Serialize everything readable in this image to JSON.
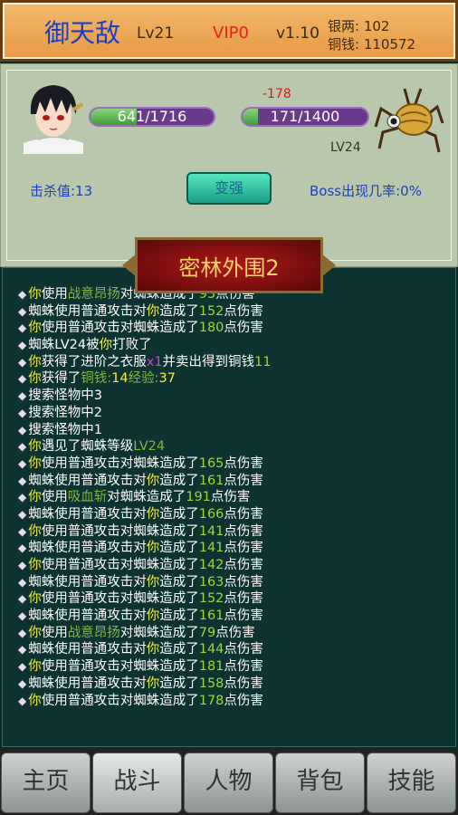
{
  "header": {
    "player_name": "御天敌",
    "level": "Lv21",
    "vip": "VIP0",
    "version": "v1.10",
    "silver": "银两: 102",
    "copper": "铜钱: 110572"
  },
  "battle": {
    "player_hp": "641/1716",
    "player_hp_fraction": 0.374,
    "enemy_hp": "171/1400",
    "enemy_hp_fraction": 0.122,
    "damage_popup": "-178",
    "enemy_level": "LV24",
    "kill_label": "击杀值:13",
    "boss_rate": "Boss出现几率:0%",
    "strengthen_button": "变强"
  },
  "zone_title": "密林外围2",
  "log": [
    [
      {
        "t": "你",
        "c": "you"
      },
      {
        "t": "使用"
      },
      {
        "t": "战意昂扬",
        "c": "skill"
      },
      {
        "t": "对蜘蛛造成了"
      },
      {
        "t": "93",
        "c": "num"
      },
      {
        "t": "点伤害"
      }
    ],
    [
      {
        "t": "蜘蛛使用普通攻击对"
      },
      {
        "t": "你",
        "c": "you"
      },
      {
        "t": "造成了"
      },
      {
        "t": "152",
        "c": "num"
      },
      {
        "t": "点伤害"
      }
    ],
    [
      {
        "t": "你",
        "c": "you"
      },
      {
        "t": "使用普通攻击对蜘蛛造成了"
      },
      {
        "t": "180",
        "c": "num"
      },
      {
        "t": "点伤害"
      }
    ],
    [
      {
        "t": "蜘蛛LV24被"
      },
      {
        "t": "你",
        "c": "you"
      },
      {
        "t": "打败了"
      }
    ],
    [
      {
        "t": "你",
        "c": "you"
      },
      {
        "t": "获得了进阶之衣服"
      },
      {
        "t": "x1",
        "c": "mag"
      },
      {
        "t": "并卖出得到铜钱"
      },
      {
        "t": "11",
        "c": "num"
      }
    ],
    [
      {
        "t": "你",
        "c": "you"
      },
      {
        "t": "获得了"
      },
      {
        "t": "铜钱:",
        "c": "skill"
      },
      {
        "t": "14",
        "c": "you"
      },
      {
        "t": "经验:",
        "c": "skill"
      },
      {
        "t": "37",
        "c": "you"
      }
    ],
    [
      {
        "t": "搜索怪物中3"
      }
    ],
    [
      {
        "t": "搜索怪物中2"
      }
    ],
    [
      {
        "t": "搜索怪物中1"
      }
    ],
    [
      {
        "t": "你",
        "c": "you"
      },
      {
        "t": "遇见了蜘蛛等级"
      },
      {
        "t": "LV24",
        "c": "skill"
      }
    ],
    [
      {
        "t": "你",
        "c": "you"
      },
      {
        "t": "使用普通攻击对蜘蛛造成了"
      },
      {
        "t": "165",
        "c": "num"
      },
      {
        "t": "点伤害"
      }
    ],
    [
      {
        "t": "蜘蛛使用普通攻击对"
      },
      {
        "t": "你",
        "c": "you"
      },
      {
        "t": "造成了"
      },
      {
        "t": "161",
        "c": "num"
      },
      {
        "t": "点伤害"
      }
    ],
    [
      {
        "t": "你",
        "c": "you"
      },
      {
        "t": "使用"
      },
      {
        "t": "吸血斩",
        "c": "skill"
      },
      {
        "t": "对蜘蛛造成了"
      },
      {
        "t": "191",
        "c": "num"
      },
      {
        "t": "点伤害"
      }
    ],
    [
      {
        "t": "蜘蛛使用普通攻击对"
      },
      {
        "t": "你",
        "c": "you"
      },
      {
        "t": "造成了"
      },
      {
        "t": "166",
        "c": "num"
      },
      {
        "t": "点伤害"
      }
    ],
    [
      {
        "t": "你",
        "c": "you"
      },
      {
        "t": "使用普通攻击对蜘蛛造成了"
      },
      {
        "t": "141",
        "c": "num"
      },
      {
        "t": "点伤害"
      }
    ],
    [
      {
        "t": "蜘蛛使用普通攻击对"
      },
      {
        "t": "你",
        "c": "you"
      },
      {
        "t": "造成了"
      },
      {
        "t": "141",
        "c": "num"
      },
      {
        "t": "点伤害"
      }
    ],
    [
      {
        "t": "你",
        "c": "you"
      },
      {
        "t": "使用普通攻击对蜘蛛造成了"
      },
      {
        "t": "142",
        "c": "num"
      },
      {
        "t": "点伤害"
      }
    ],
    [
      {
        "t": "蜘蛛使用普通攻击对"
      },
      {
        "t": "你",
        "c": "you"
      },
      {
        "t": "造成了"
      },
      {
        "t": "163",
        "c": "num"
      },
      {
        "t": "点伤害"
      }
    ],
    [
      {
        "t": "你",
        "c": "you"
      },
      {
        "t": "使用普通攻击对蜘蛛造成了"
      },
      {
        "t": "152",
        "c": "num"
      },
      {
        "t": "点伤害"
      }
    ],
    [
      {
        "t": "蜘蛛使用普通攻击对"
      },
      {
        "t": "你",
        "c": "you"
      },
      {
        "t": "造成了"
      },
      {
        "t": "161",
        "c": "num"
      },
      {
        "t": "点伤害"
      }
    ],
    [
      {
        "t": "你",
        "c": "you"
      },
      {
        "t": "使用"
      },
      {
        "t": "战意昂扬",
        "c": "skill"
      },
      {
        "t": "对蜘蛛造成了"
      },
      {
        "t": "79",
        "c": "num"
      },
      {
        "t": "点伤害"
      }
    ],
    [
      {
        "t": "蜘蛛使用普通攻击对"
      },
      {
        "t": "你",
        "c": "you"
      },
      {
        "t": "造成了"
      },
      {
        "t": "144",
        "c": "num"
      },
      {
        "t": "点伤害"
      }
    ],
    [
      {
        "t": "你",
        "c": "you"
      },
      {
        "t": "使用普通攻击对蜘蛛造成了"
      },
      {
        "t": "181",
        "c": "num"
      },
      {
        "t": "点伤害"
      }
    ],
    [
      {
        "t": "蜘蛛使用普通攻击对"
      },
      {
        "t": "你",
        "c": "you"
      },
      {
        "t": "造成了"
      },
      {
        "t": "158",
        "c": "num"
      },
      {
        "t": "点伤害"
      }
    ],
    [
      {
        "t": "你",
        "c": "you"
      },
      {
        "t": "使用普通攻击对蜘蛛造成了"
      },
      {
        "t": "178",
        "c": "num"
      },
      {
        "t": "点伤害"
      }
    ]
  ],
  "log_bullet": "◆",
  "tabs": [
    {
      "label": "主页",
      "active": false
    },
    {
      "label": "战斗",
      "active": true
    },
    {
      "label": "人物",
      "active": false
    },
    {
      "label": "背包",
      "active": false
    },
    {
      "label": "技能",
      "active": false
    }
  ],
  "icons": {
    "player_avatar": "player-avatar-icon",
    "enemy_sprite": "spider-icon"
  }
}
